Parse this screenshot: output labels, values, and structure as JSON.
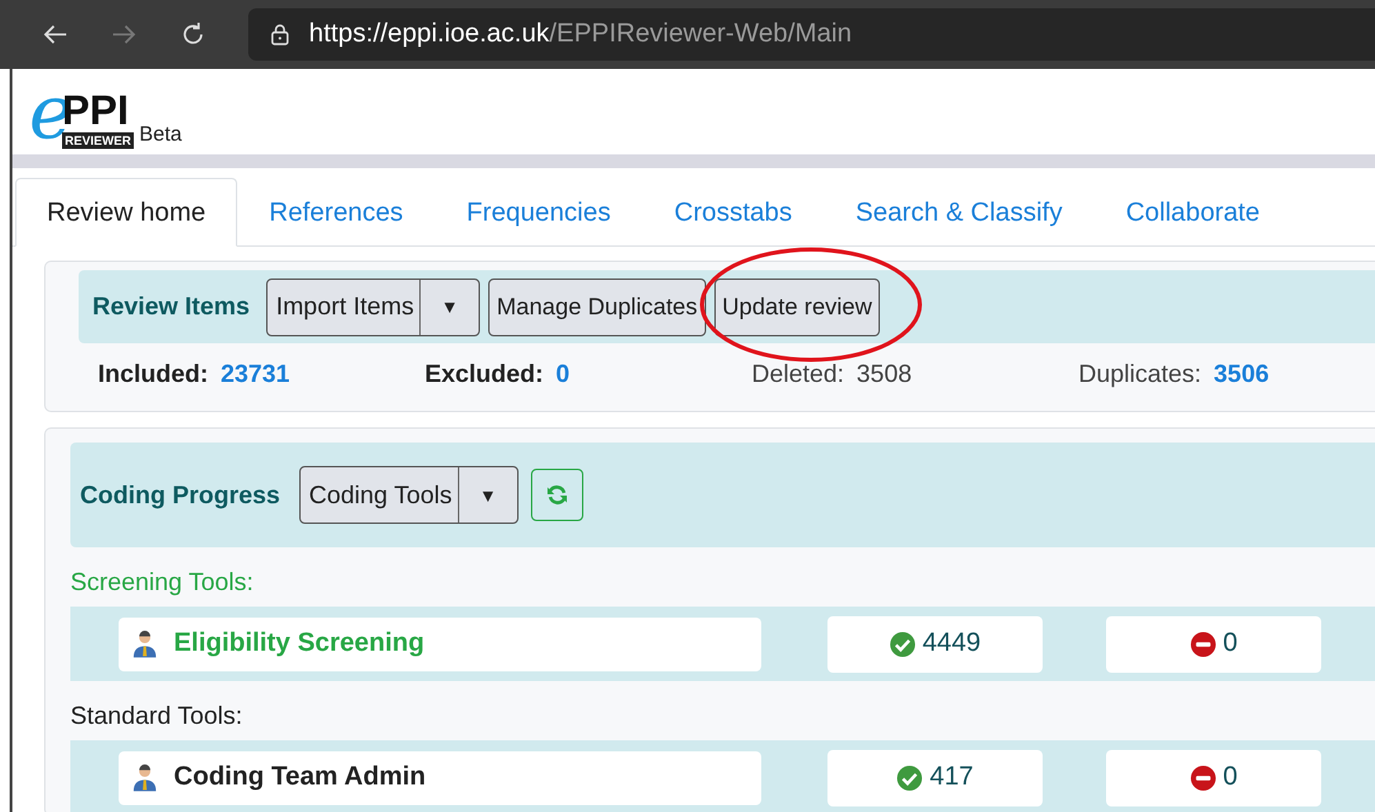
{
  "browser": {
    "url_host": "https://eppi.ioe.ac.uk",
    "url_path": "/EPPIReviewer-Web/Main"
  },
  "logo": {
    "letter": "e",
    "name": "PPI",
    "sub": "REVIEWER",
    "badge": "Beta"
  },
  "tabs": [
    {
      "label": "Review home",
      "selected": true
    },
    {
      "label": "References",
      "selected": false
    },
    {
      "label": "Frequencies",
      "selected": false
    },
    {
      "label": "Crosstabs",
      "selected": false
    },
    {
      "label": "Search & Classify",
      "selected": false
    },
    {
      "label": "Collaborate",
      "selected": false
    }
  ],
  "review_items": {
    "title": "Review Items",
    "split_button": {
      "label": "Import Items",
      "caret": "▼"
    },
    "buttons": [
      {
        "label": "Manage Duplicates",
        "circled": false
      },
      {
        "label": "Update review",
        "circled": true
      }
    ],
    "stats": [
      {
        "label": "Included:",
        "value": "23731",
        "kind": "strong"
      },
      {
        "label": "Excluded:",
        "value": "0",
        "kind": "strong"
      },
      {
        "label": "Deleted:",
        "value": "3508",
        "kind": "muted"
      },
      {
        "label": "Duplicates:",
        "value": "3506",
        "kind": "mixed"
      }
    ]
  },
  "coding_progress": {
    "title": "Coding Progress",
    "split_button": {
      "label": "Coding Tools",
      "caret": "▼"
    },
    "sections": [
      {
        "label": "Screening Tools:",
        "kind": "screening",
        "tools": [
          {
            "name": "Eligibility Screening",
            "complete": "4449",
            "incomplete": "0"
          }
        ]
      },
      {
        "label": "Standard Tools:",
        "kind": "standard",
        "tools": [
          {
            "name": "Coding Team Admin",
            "complete": "417",
            "incomplete": "0"
          }
        ]
      }
    ]
  }
}
